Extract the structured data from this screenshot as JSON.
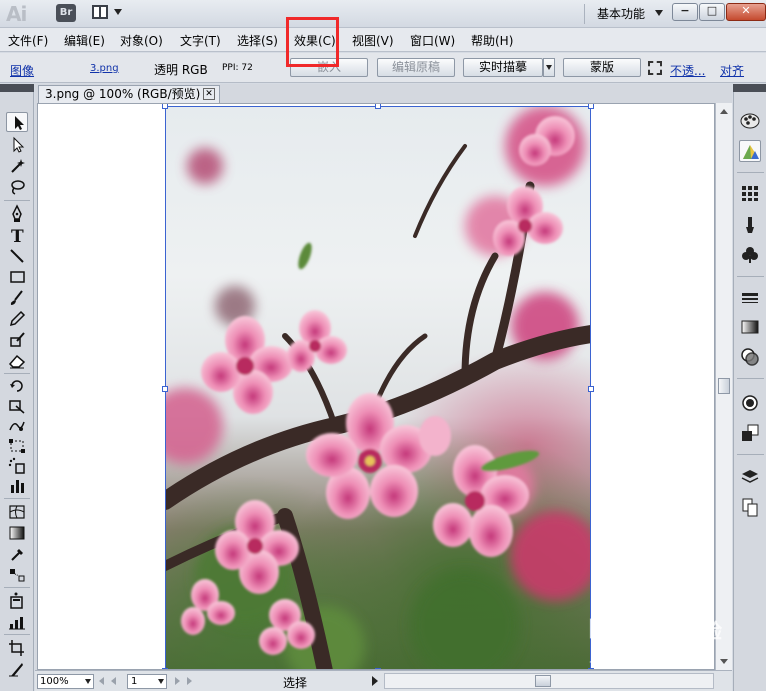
{
  "app": {
    "logo": "Ai",
    "bridge_label": "Br",
    "workspace": "基本功能"
  },
  "menu": {
    "items": [
      "文件(F)",
      "编辑(E)",
      "对象(O)",
      "文字(T)",
      "选择(S)",
      "效果(C)",
      "视图(V)",
      "窗口(W)",
      "帮助(H)"
    ]
  },
  "control": {
    "type_link": "图像",
    "file_link": "3.png",
    "mode": "透明 RGB",
    "ppi": "PPI: 72",
    "embed_button": "嵌入",
    "edit_original_button": "编辑原稿",
    "live_trace_button": "实时描摹",
    "mask_button": "蒙版",
    "opacity_link": "不透...",
    "align_link": "对齐"
  },
  "document": {
    "tab_title": "3.png @ 100% (RGB/预览)"
  },
  "status": {
    "zoom": "100%",
    "page": "1",
    "tool_text": "选择"
  },
  "watermark": {
    "brand": "Bai",
    "brand_cn": "经验",
    "url": "jingyan.baidu.com"
  },
  "colors": {
    "highlight": "#f0292a",
    "selection": "#3b63d1",
    "link": "#1133aa"
  }
}
